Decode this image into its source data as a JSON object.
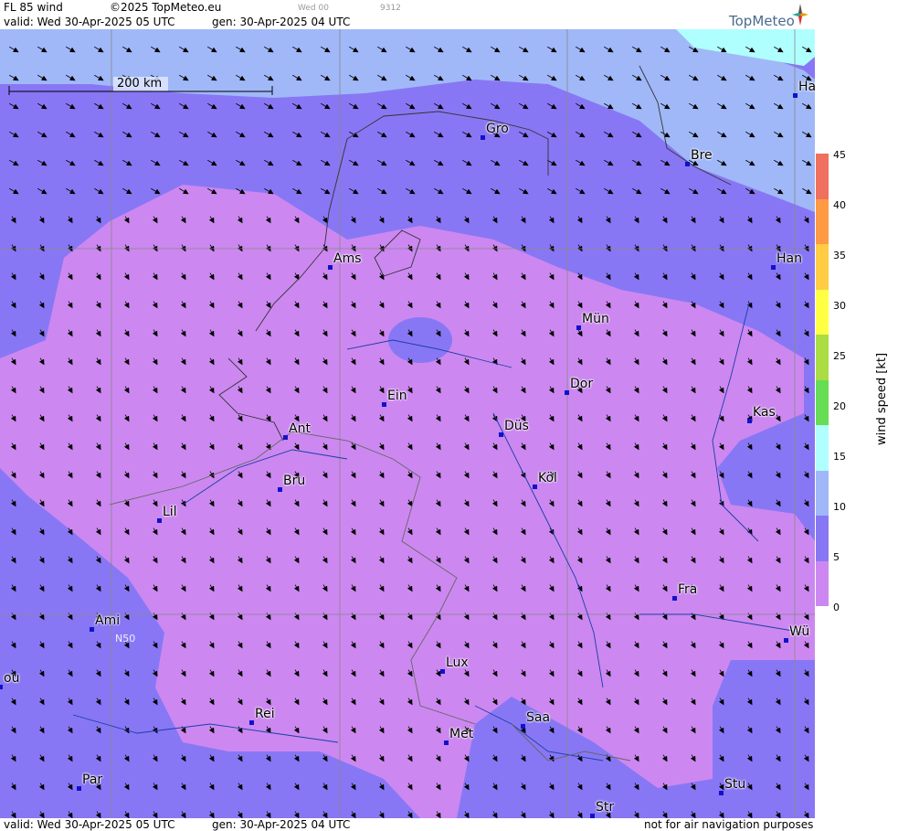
{
  "header": {
    "product": "FL 85 wind",
    "copyright": "©2025 TopMeteo.eu",
    "day_code": "Wed 00",
    "code": "9312",
    "valid": "valid:  Wed  30-Apr-2025  05 UTC",
    "gen": "gen: 30-Apr-2025 04 UTC"
  },
  "logo": {
    "text": "TopMeteo",
    "icon": "compass-star-icon"
  },
  "scale_bar": {
    "label": "200 km"
  },
  "graticule_label": "N50",
  "cities": [
    {
      "label": "Gro"
    },
    {
      "label": "Bre"
    },
    {
      "label": "Ha"
    },
    {
      "label": "Ams"
    },
    {
      "label": "Han"
    },
    {
      "label": "Mün"
    },
    {
      "label": "Dor"
    },
    {
      "label": "Ein"
    },
    {
      "label": "Kas"
    },
    {
      "label": "Ant"
    },
    {
      "label": "Düs"
    },
    {
      "label": "Bru"
    },
    {
      "label": "Köl"
    },
    {
      "label": "Lil"
    },
    {
      "label": "Fra"
    },
    {
      "label": "Ami"
    },
    {
      "label": "Wü"
    },
    {
      "label": "Lux"
    },
    {
      "label": "ou"
    },
    {
      "label": "Rei"
    },
    {
      "label": "Saa"
    },
    {
      "label": "Met"
    },
    {
      "label": "Par"
    },
    {
      "label": "Stu"
    },
    {
      "label": "Str"
    }
  ],
  "legend": {
    "title": "wind  speed  [kt]",
    "ticks": [
      "45",
      "40",
      "35",
      "30",
      "25",
      "20",
      "15",
      "10",
      "5",
      "0"
    ],
    "colors": [
      "#cc88f0",
      "#8877f4",
      "#a0b8f8",
      "#b0ffff",
      "#66dd55",
      "#aadd44",
      "#ffff44",
      "#ffcc44",
      "#ff9944",
      "#f07060"
    ]
  },
  "footer": {
    "valid": "valid:  Wed  30-Apr-2025  05 UTC",
    "gen": "gen: 30-Apr-2025 04 UTC",
    "disclaimer": "not for air navigation purposes"
  }
}
